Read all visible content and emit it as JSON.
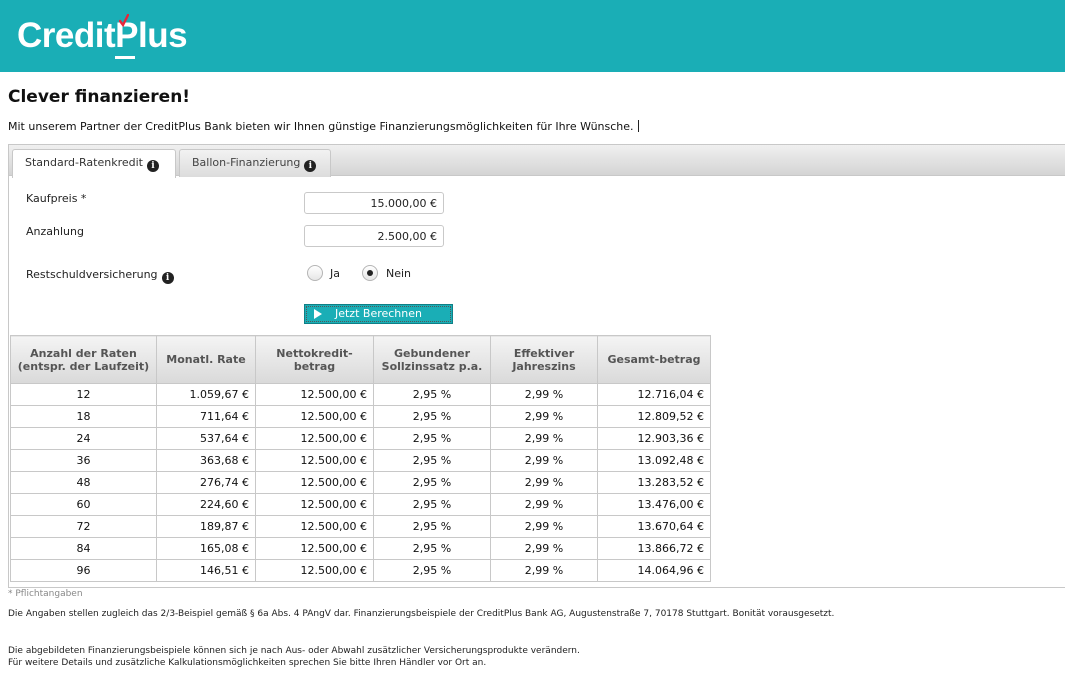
{
  "header": {
    "logo_main": "Credit",
    "logo_p": "P",
    "logo_rest": "lus",
    "brand_color": "#1aaeb6",
    "accent_color": "#e5263a"
  },
  "page": {
    "title": "Clever finanzieren!",
    "intro": "Mit unserem Partner der CreditPlus Bank bieten wir Ihnen günstige Finanzierungsmöglichkeiten für Ihre Wünsche."
  },
  "tabs": [
    {
      "label": "Standard-Ratenkredit",
      "icon": "info-icon",
      "active": true
    },
    {
      "label": "Ballon-Finanzierung",
      "icon": "info-icon",
      "active": false
    }
  ],
  "form": {
    "kaufpreis_label": "Kaufpreis *",
    "kaufpreis_value": "15.000,00 €",
    "anzahlung_label": "Anzahlung",
    "anzahlung_value": "2.500,00 €",
    "rsv_label": "Restschuldversicherung",
    "rsv_yes": "Ja",
    "rsv_no": "Nein",
    "rsv_selected": "Nein",
    "submit_label": "Jetzt Berechnen"
  },
  "table": {
    "headers": [
      "Anzahl der Raten (entspr. der Laufzeit)",
      "Monatl. Rate",
      "Nettokredit-betrag",
      "Gebundener Sollzinssatz p.a.",
      "Effektiver Jahreszins",
      "Gesamt-betrag"
    ],
    "rows": [
      [
        "12",
        "1.059,67 €",
        "12.500,00 €",
        "2,95 %",
        "2,99 %",
        "12.716,04 €"
      ],
      [
        "18",
        "711,64 €",
        "12.500,00 €",
        "2,95 %",
        "2,99 %",
        "12.809,52 €"
      ],
      [
        "24",
        "537,64 €",
        "12.500,00 €",
        "2,95 %",
        "2,99 %",
        "12.903,36 €"
      ],
      [
        "36",
        "363,68 €",
        "12.500,00 €",
        "2,95 %",
        "2,99 %",
        "13.092,48 €"
      ],
      [
        "48",
        "276,74 €",
        "12.500,00 €",
        "2,95 %",
        "2,99 %",
        "13.283,52 €"
      ],
      [
        "60",
        "224,60 €",
        "12.500,00 €",
        "2,95 %",
        "2,99 %",
        "13.476,00 €"
      ],
      [
        "72",
        "189,87 €",
        "12.500,00 €",
        "2,95 %",
        "2,99 %",
        "13.670,64 €"
      ],
      [
        "84",
        "165,08 €",
        "12.500,00 €",
        "2,95 %",
        "2,99 %",
        "13.866,72 €"
      ],
      [
        "96",
        "146,51 €",
        "12.500,00 €",
        "2,95 %",
        "2,99 %",
        "14.064,96 €"
      ]
    ]
  },
  "notes": {
    "required": "* Pflichtangaben",
    "legal": "Die Angaben stellen zugleich das 2/3-Beispiel gemäß § 6a Abs. 4 PAngV dar. Finanzierungsbeispiele der CreditPlus Bank AG, Augustenstraße 7, 70178 Stuttgart. Bonität vorausgesetzt.",
    "variation": "Die abgebildeten Finanzierungsbeispiele können sich je nach Aus- oder Abwahl zusätzlicher Versicherungsprodukte verändern.",
    "dealer": "Für weitere Details und zusätzliche Kalkulationsmöglichkeiten sprechen Sie bitte Ihren Händler vor Ort an."
  }
}
